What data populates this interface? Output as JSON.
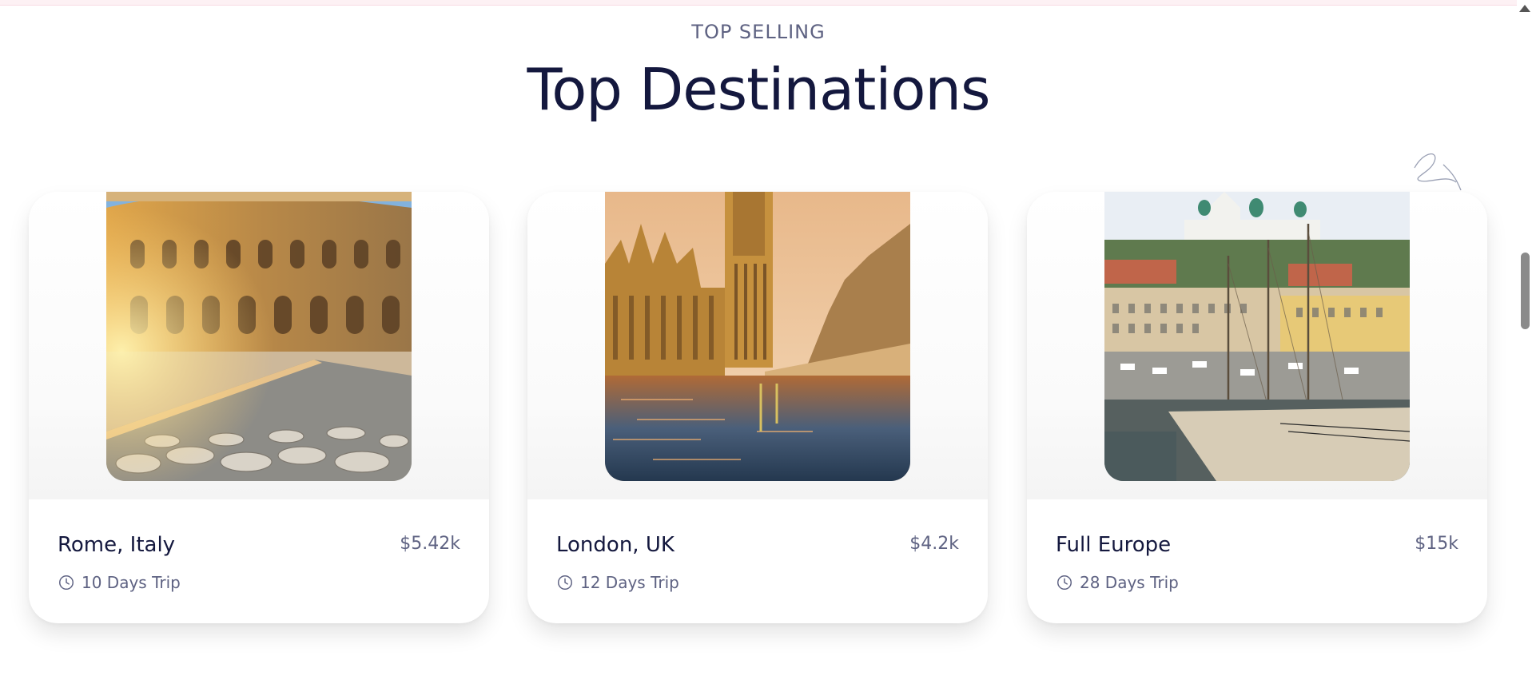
{
  "section": {
    "eyebrow": "TOP SELLING",
    "title": "Top Destinations"
  },
  "cards": [
    {
      "title": "Rome, Italy",
      "price": "$5.42k",
      "duration": "10 Days Trip",
      "image": "colosseum"
    },
    {
      "title": "London, UK",
      "price": "$4.2k",
      "duration": "12 Days Trip",
      "image": "big-ben"
    },
    {
      "title": "Full Europe",
      "price": "$15k",
      "duration": "28 Days Trip",
      "image": "helsinki-harbor"
    }
  ],
  "icons": {
    "duration": "clock-icon",
    "decor": "squiggle-decoration"
  },
  "colors": {
    "heading": "#14183e",
    "muted": "#5e6282"
  }
}
